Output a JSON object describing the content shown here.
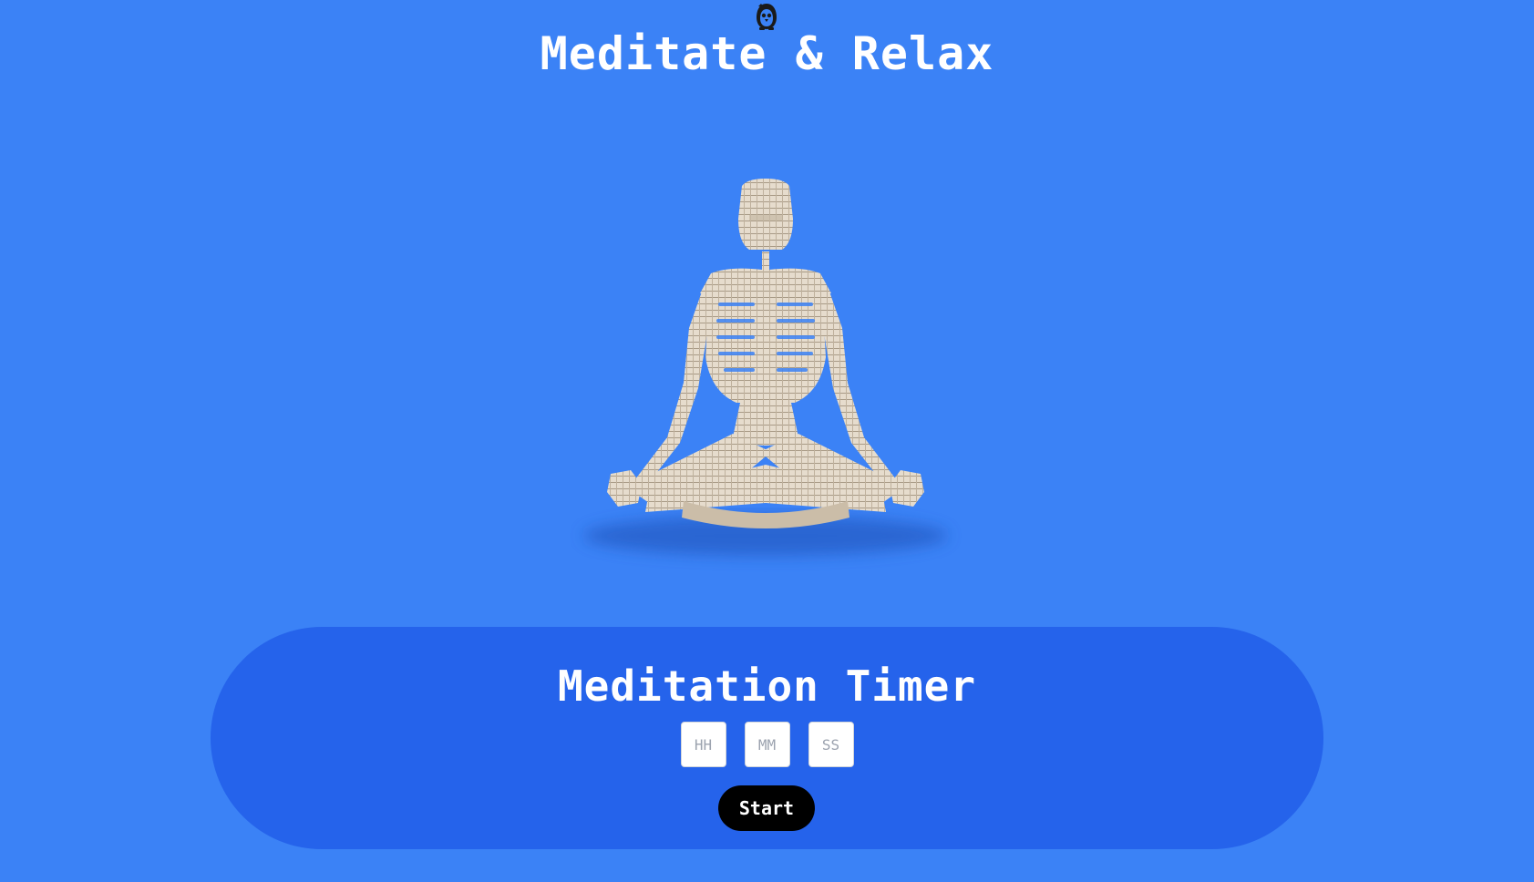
{
  "header": {
    "logo_icon": "penguin-logo-icon",
    "title": "Meditate & Relax"
  },
  "hero": {
    "figure": "meditating-skeleton-illustration"
  },
  "timer": {
    "title": "Meditation Timer",
    "hours_placeholder": "HH",
    "minutes_placeholder": "MM",
    "seconds_placeholder": "SS",
    "start_label": "Start"
  },
  "colors": {
    "background": "#3b82f6",
    "panel": "#2563eb",
    "button": "#000000",
    "text": "#ffffff"
  }
}
